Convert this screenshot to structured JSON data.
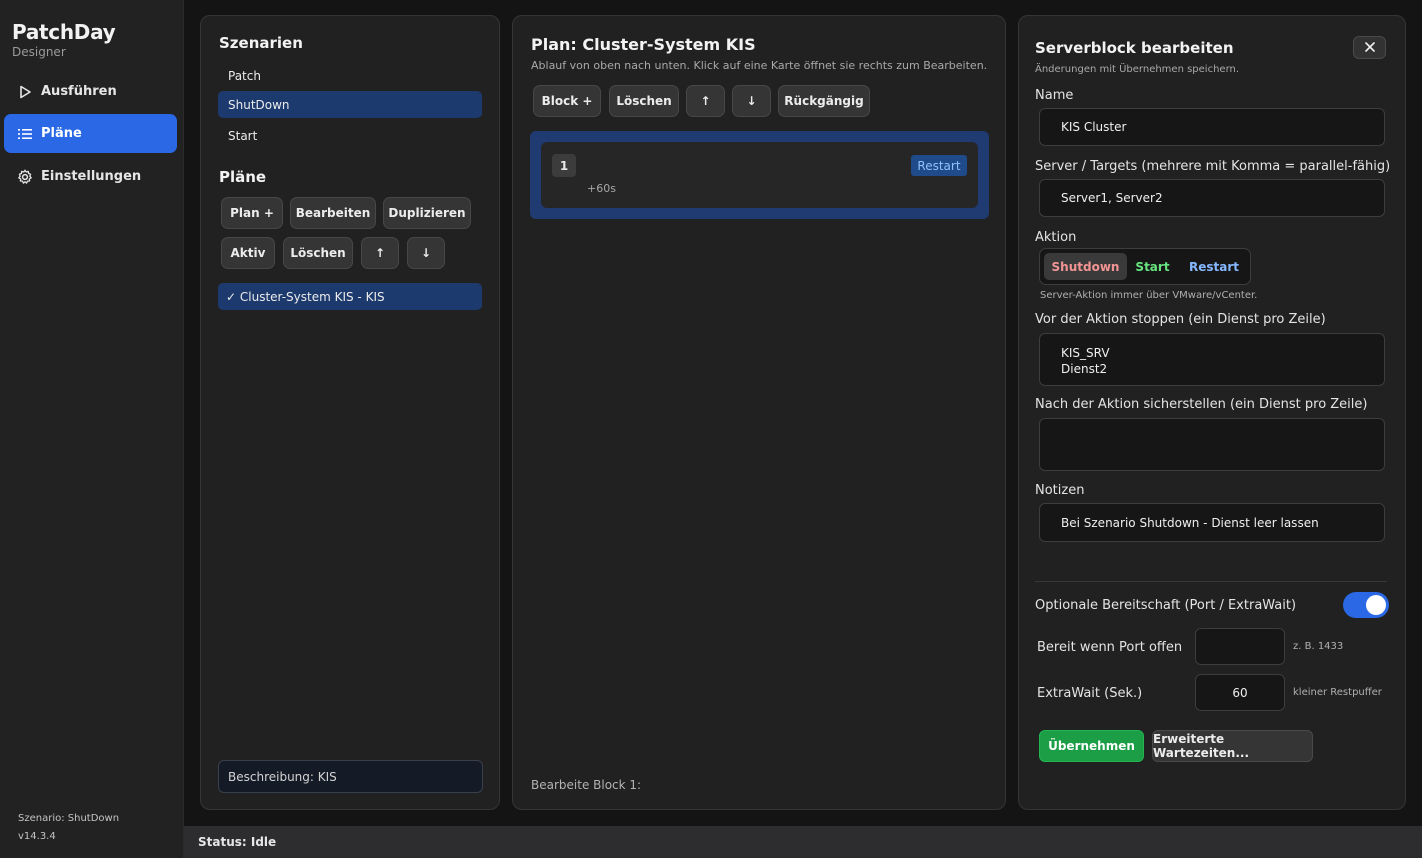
{
  "app": {
    "title": "PatchDay",
    "subtitle": "Designer"
  },
  "nav": [
    {
      "label": "Ausführen",
      "icon": "play-icon"
    },
    {
      "label": "Pläne",
      "icon": "list-icon",
      "active": true
    },
    {
      "label": "Einstellungen",
      "icon": "gear-icon"
    }
  ],
  "footer": {
    "scenario": "Szenario: ShutDown",
    "version": "v14.3.4"
  },
  "status": "Status: Idle",
  "scenarios": {
    "title": "Szenarien",
    "items": [
      "Patch",
      "ShutDown",
      "Start"
    ],
    "selected": "ShutDown"
  },
  "plans": {
    "title": "Pläne",
    "buttons": [
      "Plan +",
      "Bearbeiten",
      "Duplizieren",
      "Aktiv",
      "Löschen",
      "↑",
      "↓"
    ],
    "items": [
      "✓ Cluster-System KIS - KIS"
    ],
    "description": "Beschreibung: KIS"
  },
  "plan_view": {
    "title": "Plan: Cluster-System KIS",
    "subtitle": "Ablauf von oben nach unten. Klick auf eine Karte öffnet sie rechts zum Bearbeiten.",
    "toolbar": [
      "Block +",
      "Löschen",
      "↑",
      "↓",
      "Rückgängig"
    ],
    "block": {
      "number": "1",
      "wait": "+60s",
      "action": "Restart"
    },
    "editing": "Bearbeite Block 1:"
  },
  "editor": {
    "title": "Serverblock bearbeiten",
    "subtitle": "Änderungen mit Übernehmen speichern.",
    "name_label": "Name",
    "name_value": "KIS Cluster",
    "targets_label": "Server / Targets (mehrere mit Komma = parallel-fähig)",
    "targets_value": "Server1, Server2",
    "action_label": "Aktion",
    "actions": [
      "Shutdown",
      "Start",
      "Restart"
    ],
    "action_selected": "Shutdown",
    "action_hint": "Server-Aktion immer über VMware/vCenter.",
    "stop_label": "Vor der Aktion stoppen (ein Dienst pro Zeile)",
    "stop_lines": [
      "KIS_SRV",
      "Dienst2"
    ],
    "ensure_label": "Nach der Aktion sicherstellen (ein Dienst pro Zeile)",
    "ensure_value": "",
    "notes_label": "Notizen",
    "notes_value": "Bei Szenario Shutdown - Dienst leer lassen",
    "readiness_label": "Optionale Bereitschaft (Port / ExtraWait)",
    "readiness_enabled": true,
    "port_label": "Bereit wenn Port offen",
    "port_value": "",
    "port_hint": "z. B. 1433",
    "extrawait_label": "ExtraWait (Sek.)",
    "extrawait_value": "60",
    "extrawait_hint": "kleiner Restpuffer",
    "apply_button": "Übernehmen",
    "advanced_button": "Erweiterte Wartezeiten..."
  },
  "colors": {
    "accent": "#2a68e6",
    "selection": "#1d3a6e",
    "apply": "#1b9e45"
  }
}
